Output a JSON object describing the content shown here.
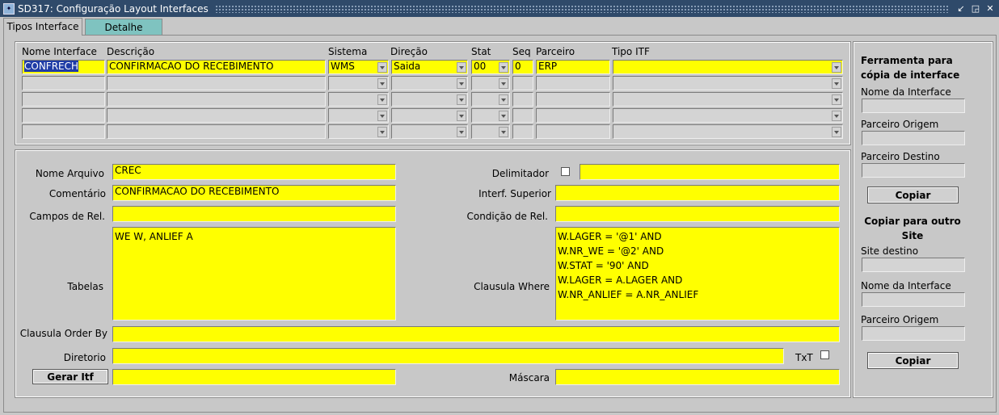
{
  "window": {
    "title": "SD317: Configuração Layout Interfaces",
    "app_icon": "oracle-forms-icon",
    "controls": [
      "minimize-icon",
      "restore-icon",
      "close-icon"
    ]
  },
  "tabs": [
    {
      "label": "Tipos Interface",
      "active": true
    },
    {
      "label": "Detalhe",
      "active": false
    }
  ],
  "grid": {
    "headers": {
      "nome": "Nome Interface",
      "descricao": "Descrição",
      "sistema": "Sistema",
      "direcao": "Direção",
      "stat": "Stat",
      "seq": "Seq",
      "parceiro": "Parceiro",
      "tipo_itf": "Tipo ITF"
    },
    "rows": [
      {
        "nome": "CONFRECH",
        "descricao": "CONFIRMACAO DO RECEBIMENTO",
        "sistema": "WMS",
        "direcao": "Saida",
        "stat": "00",
        "seq": "0",
        "parceiro": "ERP",
        "tipo_itf": ""
      },
      {
        "nome": "",
        "descricao": "",
        "sistema": "",
        "direcao": "",
        "stat": "",
        "seq": "",
        "parceiro": "",
        "tipo_itf": ""
      },
      {
        "nome": "",
        "descricao": "",
        "sistema": "",
        "direcao": "",
        "stat": "",
        "seq": "",
        "parceiro": "",
        "tipo_itf": ""
      },
      {
        "nome": "",
        "descricao": "",
        "sistema": "",
        "direcao": "",
        "stat": "",
        "seq": "",
        "parceiro": "",
        "tipo_itf": ""
      },
      {
        "nome": "",
        "descricao": "",
        "sistema": "",
        "direcao": "",
        "stat": "",
        "seq": "",
        "parceiro": "",
        "tipo_itf": ""
      }
    ]
  },
  "detail": {
    "nome_arquivo": {
      "label": "Nome Arquivo",
      "value": "CREC"
    },
    "comentario": {
      "label": "Comentário",
      "value": "CONFIRMACAO DO RECEBIMENTO"
    },
    "campos_rel": {
      "label": "Campos de Rel.",
      "value": ""
    },
    "tabelas": {
      "label": "Tabelas",
      "value": "WE W, ANLIEF A"
    },
    "order_by": {
      "label": "Clausula Order By",
      "value": ""
    },
    "diretorio": {
      "label": "Diretorio",
      "value": ""
    },
    "gerar_itf": {
      "label": "Gerar Itf",
      "value": ""
    },
    "delimitador": {
      "label": "Delimitador",
      "checked": false,
      "value": ""
    },
    "interf_superior": {
      "label": "Interf. Superior",
      "value": ""
    },
    "condicao_rel": {
      "label": "Condição de Rel.",
      "value": ""
    },
    "clausula_where": {
      "label": "Clausula Where",
      "value": "W.LAGER = '@1' AND\nW.NR_WE = '@2' AND\nW.STAT = '90' AND\nW.LAGER = A.LAGER AND\nW.NR_ANLIEF = A.NR_ANLIEF"
    },
    "txt": {
      "label": "TxT",
      "checked": false
    },
    "mascara": {
      "label": "Máscara",
      "value": ""
    }
  },
  "side": {
    "copy_interface": {
      "title": "Ferramenta para cópia de interface",
      "nome_label": "Nome da Interface",
      "origem_label": "Parceiro Origem",
      "destino_label": "Parceiro Destino",
      "button": "Copiar"
    },
    "copy_site": {
      "title": "Copiar para outro Site",
      "site_label": "Site destino",
      "nome_label": "Nome da Interface",
      "origem_label": "Parceiro Origem",
      "button": "Copiar"
    }
  }
}
